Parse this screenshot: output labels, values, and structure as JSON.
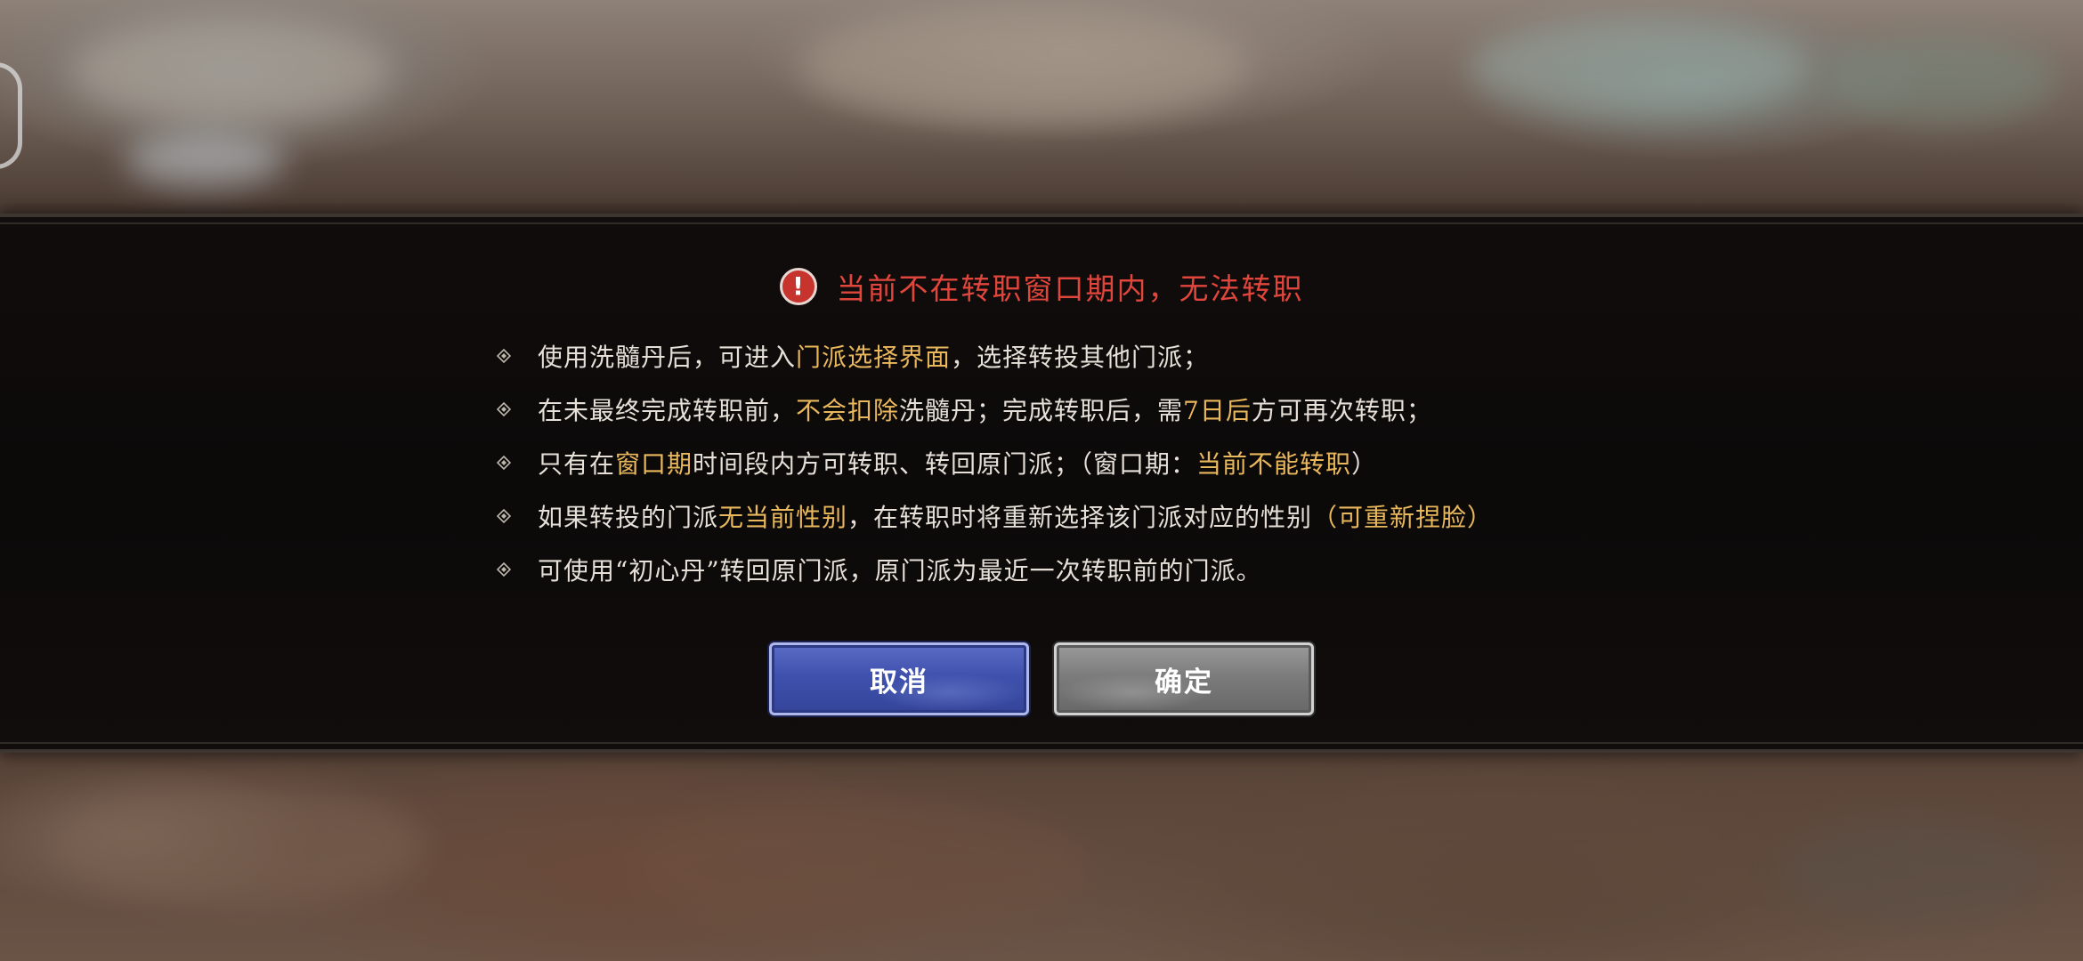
{
  "dialog": {
    "title": "当前不在转职窗口期内，无法转职",
    "icon": "alert-icon",
    "colors": {
      "title": "#e0463c",
      "highlight": "#e9b75c",
      "text": "#e6e0d8",
      "cancel_button": "#3f51ad",
      "confirm_button": "#7c7c7c"
    },
    "rules": [
      {
        "segments": [
          {
            "text": "使用洗髓丹后，可进入",
            "hl": false
          },
          {
            "text": "门派选择界面",
            "hl": true
          },
          {
            "text": "，选择转投其他门派；",
            "hl": false
          }
        ]
      },
      {
        "segments": [
          {
            "text": "在未最终完成转职前，",
            "hl": false
          },
          {
            "text": "不会扣除",
            "hl": true
          },
          {
            "text": "洗髓丹；完成转职后，需",
            "hl": false
          },
          {
            "text": "7日后",
            "hl": true
          },
          {
            "text": "方可再次转职；",
            "hl": false
          }
        ]
      },
      {
        "segments": [
          {
            "text": "只有在",
            "hl": false
          },
          {
            "text": "窗口期",
            "hl": true
          },
          {
            "text": "时间段内方可转职、转回原门派；（窗口期：",
            "hl": false
          },
          {
            "text": "当前不能转职",
            "hl": true
          },
          {
            "text": "）",
            "hl": false
          }
        ]
      },
      {
        "segments": [
          {
            "text": "如果转投的门派",
            "hl": false
          },
          {
            "text": "无当前性别",
            "hl": true
          },
          {
            "text": "，在转职时将重新选择该门派对应的性别",
            "hl": false
          },
          {
            "text": "（可重新捏脸）",
            "hl": true
          }
        ]
      },
      {
        "segments": [
          {
            "text": "可使用“初心丹”转回原门派，原门派为最近一次转职前的门派。",
            "hl": false
          }
        ]
      }
    ],
    "buttons": {
      "cancel_label": "取消",
      "confirm_label": "确定"
    }
  }
}
